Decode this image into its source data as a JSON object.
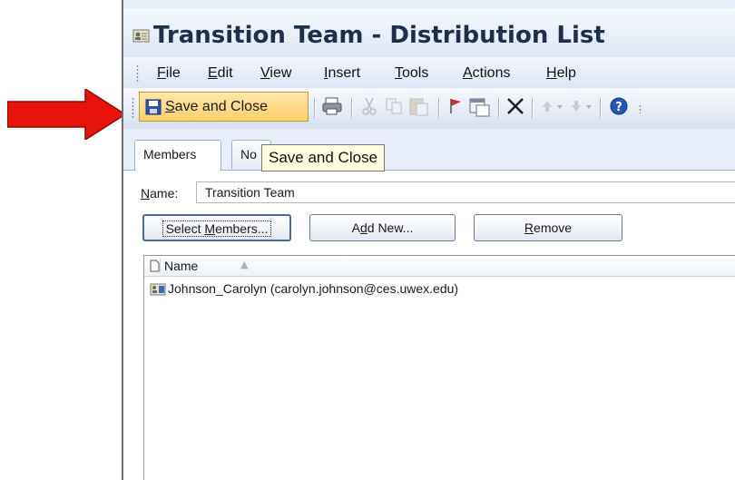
{
  "window": {
    "title": "Transition Team - Distribution List"
  },
  "menubar": {
    "items": [
      {
        "mnemonic": "F",
        "rest": "ile"
      },
      {
        "mnemonic": "E",
        "rest": "dit"
      },
      {
        "mnemonic": "V",
        "rest": "iew"
      },
      {
        "mnemonic": "I",
        "rest": "nsert"
      },
      {
        "mnemonic": "T",
        "rest": "ools"
      },
      {
        "mnemonic": "A",
        "rest": "ctions"
      },
      {
        "mnemonic": "H",
        "rest": "elp"
      }
    ]
  },
  "toolbar": {
    "save_close": {
      "mnemonic": "S",
      "rest": "ave and Close"
    },
    "icons": [
      "print-icon",
      "cut-icon",
      "copy-icon",
      "paste-icon",
      "flag-icon",
      "categorize-icon",
      "delete-icon",
      "previous-item-icon",
      "next-item-icon",
      "help-icon"
    ]
  },
  "tooltip": {
    "text": "Save and Close"
  },
  "tabs": {
    "members": "Members",
    "notes_partial": "No"
  },
  "form": {
    "name_label_mnemonic": "N",
    "name_label_rest": "ame:",
    "name_value": "Transition Team"
  },
  "buttons": {
    "select_members": {
      "before": "Select ",
      "mnemonic": "M",
      "after": "embers..."
    },
    "add_new": {
      "before": "A",
      "mnemonic": "d",
      "after": "d New..."
    },
    "remove": {
      "before": "",
      "mnemonic": "R",
      "after": "emove"
    }
  },
  "members_list": {
    "column_header": "Name",
    "rows": [
      {
        "display": "Johnson_Carolyn (carolyn.johnson@ces.uwex.edu)"
      }
    ]
  },
  "colors": {
    "annotation_arrow": "#e8140c",
    "save_button_highlight": "#ffd88a",
    "tooltip_bg": "#ffffe1"
  }
}
